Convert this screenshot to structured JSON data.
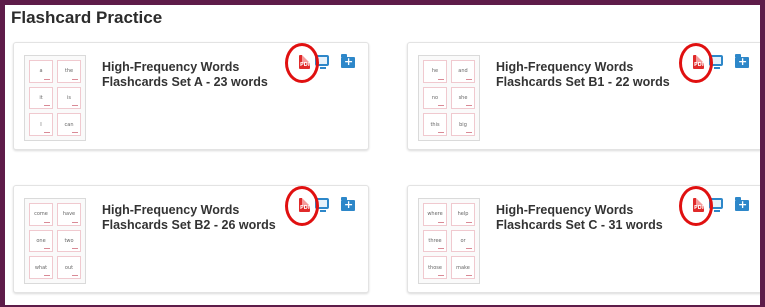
{
  "page": {
    "title": "Flashcard Practice"
  },
  "colors": {
    "frame": "#5e1c49",
    "pdf": "#e02a2a",
    "accent_blue": "#2d87c9",
    "highlight": "#e01010"
  },
  "cards": [
    {
      "title": "High-Frequency Words Flashcards Set A - 23 words",
      "thumb_words": [
        "a",
        "the",
        "it",
        "is",
        "I",
        "can"
      ],
      "icons": [
        "pdf-icon",
        "screen-icon",
        "add-folder-icon"
      ]
    },
    {
      "title": "High-Frequency Words Flashcards Set B1 - 22 words",
      "thumb_words": [
        "he",
        "and",
        "no",
        "she",
        "this",
        "big"
      ],
      "icons": [
        "pdf-icon",
        "screen-icon",
        "add-folder-icon"
      ]
    },
    {
      "title": "High-Frequency Words Flashcards Set B2 - 26 words",
      "thumb_words": [
        "come",
        "have",
        "one",
        "two",
        "what",
        "out"
      ],
      "icons": [
        "pdf-icon",
        "screen-icon",
        "add-folder-icon"
      ]
    },
    {
      "title": "High-Frequency Words Flashcards Set C - 31 words",
      "thumb_words": [
        "where",
        "help",
        "three",
        "or",
        "those",
        "make"
      ],
      "icons": [
        "pdf-icon",
        "screen-icon",
        "add-folder-icon"
      ]
    }
  ]
}
